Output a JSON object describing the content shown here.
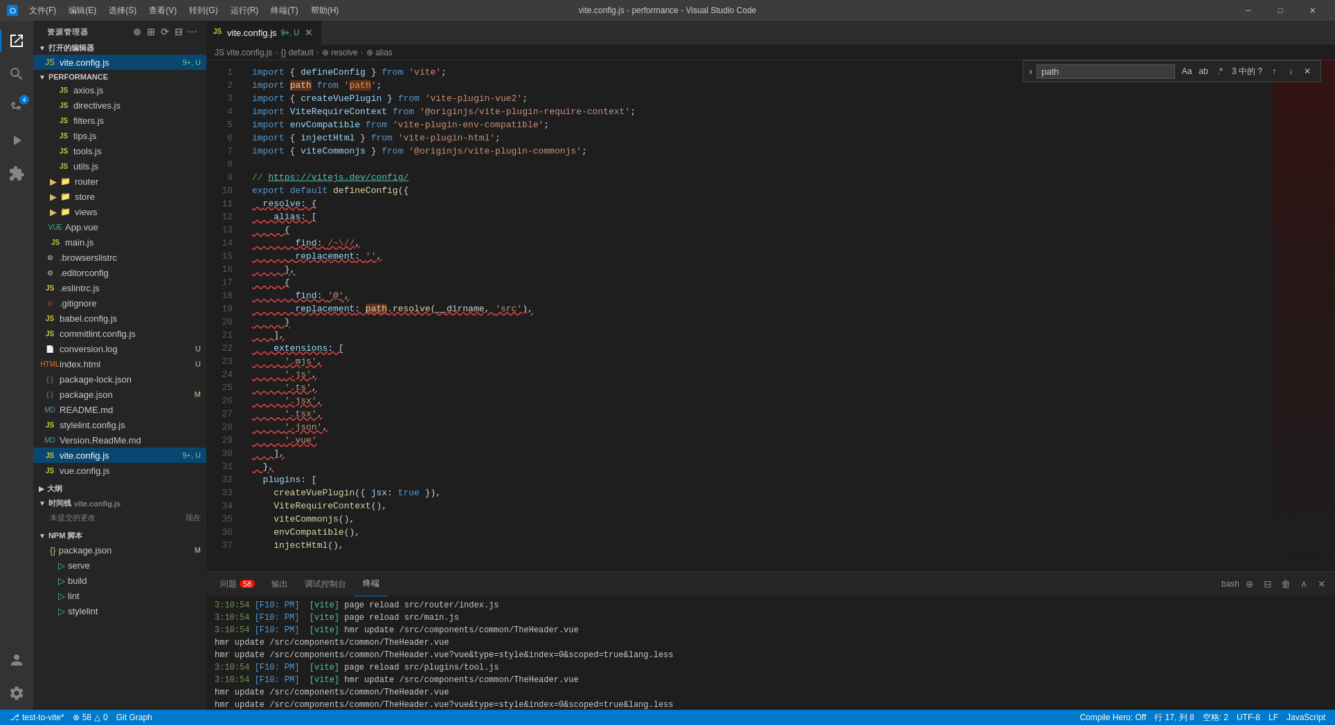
{
  "titlebar": {
    "title": "vite.config.js - performance - Visual Studio Code",
    "menu_items": [
      "文件(F)",
      "编辑(E)",
      "选择(S)",
      "查看(V)",
      "转到(G)",
      "运行(R)",
      "终端(T)",
      "帮助(H)"
    ]
  },
  "sidebar": {
    "header": "资源管理器",
    "open_editors": "打开的编辑器",
    "open_files": [
      {
        "name": "vite.config.js",
        "badge": "9+, U",
        "active": true
      }
    ],
    "folder_name": "PERFORMANCE",
    "files": [
      {
        "name": "axios.js",
        "type": "js",
        "indent": 1
      },
      {
        "name": "directives.js",
        "type": "js",
        "indent": 1
      },
      {
        "name": "filters.js",
        "type": "js",
        "indent": 1
      },
      {
        "name": "tips.js",
        "type": "js",
        "indent": 1
      },
      {
        "name": "tools.js",
        "type": "js",
        "indent": 1
      },
      {
        "name": "utils.js",
        "type": "js",
        "indent": 1
      },
      {
        "name": "router",
        "type": "folder",
        "indent": 1
      },
      {
        "name": "store",
        "type": "folder",
        "indent": 1
      },
      {
        "name": "views",
        "type": "folder",
        "indent": 1
      },
      {
        "name": "App.vue",
        "type": "vue",
        "indent": 1
      },
      {
        "name": "main.js",
        "type": "js",
        "indent": 1
      },
      {
        "name": ".browserslistrc",
        "type": "config",
        "indent": 0
      },
      {
        "name": ".editorconfig",
        "type": "config",
        "indent": 0
      },
      {
        "name": ".eslintrc.js",
        "type": "js",
        "indent": 0
      },
      {
        "name": ".gitignore",
        "type": "git",
        "indent": 0
      },
      {
        "name": "babel.config.js",
        "type": "js",
        "indent": 0
      },
      {
        "name": "commitlint.config.js",
        "type": "js",
        "indent": 0
      },
      {
        "name": "conversion.log",
        "type": "log",
        "indent": 0,
        "badge": "U"
      },
      {
        "name": "index.html",
        "type": "html",
        "indent": 0,
        "badge": "U"
      },
      {
        "name": "package-lock.json",
        "type": "json",
        "indent": 0
      },
      {
        "name": "package.json",
        "type": "json",
        "indent": 0,
        "badge": "M"
      },
      {
        "name": "README.md",
        "type": "md",
        "indent": 0
      },
      {
        "name": "stylelint.config.js",
        "type": "js",
        "indent": 0
      },
      {
        "name": "Version.ReadMe.md",
        "type": "md",
        "indent": 0
      },
      {
        "name": "vite.config.js",
        "type": "js",
        "indent": 0,
        "badge": "9+, U",
        "active": true
      },
      {
        "name": "vue.config.js",
        "type": "js",
        "indent": 0
      }
    ],
    "sections": [
      {
        "name": "大纲"
      },
      {
        "name": "时间线",
        "subtitle": "vite.config.js"
      },
      {
        "name": "未提交的更改",
        "badge": "现在"
      }
    ],
    "npm_scripts": {
      "title": "NPM 脚本",
      "package": "package.json",
      "scripts": [
        "serve",
        "build",
        "lint",
        "stylelint"
      ]
    }
  },
  "editor": {
    "tab_name": "vite.config.js",
    "tab_badge": "9+, U",
    "breadcrumb": [
      "JS vite.config.js",
      "{} default",
      "⊕ resolve",
      "⊕ alias"
    ],
    "find_widget": {
      "query": "path",
      "count": "3 中的 ?",
      "options": [
        "Aa",
        "ab",
        ".*"
      ]
    },
    "lines": [
      {
        "num": 1,
        "code": "import { defineConfig } from 'vite';"
      },
      {
        "num": 2,
        "code": "import path from 'path';"
      },
      {
        "num": 3,
        "code": "import { createVuePlugin } from 'vite-plugin-vue2';"
      },
      {
        "num": 4,
        "code": "import ViteRequireContext from '@originjs/vite-plugin-require-context';"
      },
      {
        "num": 5,
        "code": "import envCompatible from 'vite-plugin-env-compatible';"
      },
      {
        "num": 6,
        "code": "import { injectHtml } from 'vite-plugin-html';"
      },
      {
        "num": 7,
        "code": "import { viteCommonjs } from '@originjs/vite-plugin-commonjs';"
      },
      {
        "num": 8,
        "code": ""
      },
      {
        "num": 9,
        "code": "// https://vitejs.dev/config/"
      },
      {
        "num": 10,
        "code": "export default defineConfig({"
      },
      {
        "num": 11,
        "code": "  resolve: {"
      },
      {
        "num": 12,
        "code": "    alias: ["
      },
      {
        "num": 13,
        "code": "      {"
      },
      {
        "num": 14,
        "code": "        find: /~\\/,/"
      },
      {
        "num": 15,
        "code": "        replacement: '',"
      },
      {
        "num": 16,
        "code": "      },"
      },
      {
        "num": 17,
        "code": "      {"
      },
      {
        "num": 18,
        "code": "        find: '@',"
      },
      {
        "num": 19,
        "code": "        replacement: path.resolve(__dirname, 'src'),"
      },
      {
        "num": 20,
        "code": "      }"
      },
      {
        "num": 21,
        "code": "    ],"
      },
      {
        "num": 22,
        "code": "    extensions: ["
      },
      {
        "num": 23,
        "code": "      '.mjs',"
      },
      {
        "num": 24,
        "code": "      '.js',"
      },
      {
        "num": 25,
        "code": "      '.ts',"
      },
      {
        "num": 26,
        "code": "      '.jsx',"
      },
      {
        "num": 27,
        "code": "      '.tsx',"
      },
      {
        "num": 28,
        "code": "      '.json',"
      },
      {
        "num": 29,
        "code": "      '.vue'"
      },
      {
        "num": 30,
        "code": "    ],"
      },
      {
        "num": 31,
        "code": "  },"
      },
      {
        "num": 32,
        "code": "  plugins: ["
      },
      {
        "num": 33,
        "code": "    createVuePlugin({ jsx: true }),"
      },
      {
        "num": 34,
        "code": "    ViteRequireContext(),"
      },
      {
        "num": 35,
        "code": "    viteCommonjs(),"
      },
      {
        "num": 36,
        "code": "    envCompatible(),"
      },
      {
        "num": 37,
        "code": "    injectHtml(),"
      }
    ]
  },
  "panel": {
    "tabs": [
      {
        "name": "问题",
        "badge": "58"
      },
      {
        "name": "输出"
      },
      {
        "name": "调试控制台"
      },
      {
        "name": "终端",
        "active": true
      }
    ],
    "terminal_label": "bash",
    "terminal_lines": [
      "3:10:54  [F10: PM]  [vite] page reload src/router/index.js",
      "3:10:54  [F10: PM]  [vite] page reload src/main.js",
      "3:10:54  [F10: PM]  [vite] hmr update /src/components/common/TheHeader.vue",
      "hmr update /src/components/common/TheHeader.vue",
      "hmr update /src/components/common/TheHeader.vue?vue&type=style&index=0&scoped=true&lang.less",
      "3:10:54  [F10: PM]  [vite] page reload src/plugins/tool.js",
      "3:10:54  [F10: PM]  [vite] hmr update /src/components/common/TheHeader.vue",
      "hmr update /src/components/common/TheHeader.vue",
      "hmr update /src/components/common/TheHeader.vue?vue&type=style&index=0&scoped=true&lang.less"
    ]
  },
  "statusbar": {
    "branch": "test-to-vite*",
    "errors": "⊗ 58",
    "warnings": "△ 0",
    "git_graph": "Git Graph",
    "compile": "Compile Hero: Off",
    "line": "行 17, 列 8",
    "spaces": "空格: 2",
    "encoding": "UTF-8",
    "eol": "LF",
    "language": "JavaScript"
  }
}
